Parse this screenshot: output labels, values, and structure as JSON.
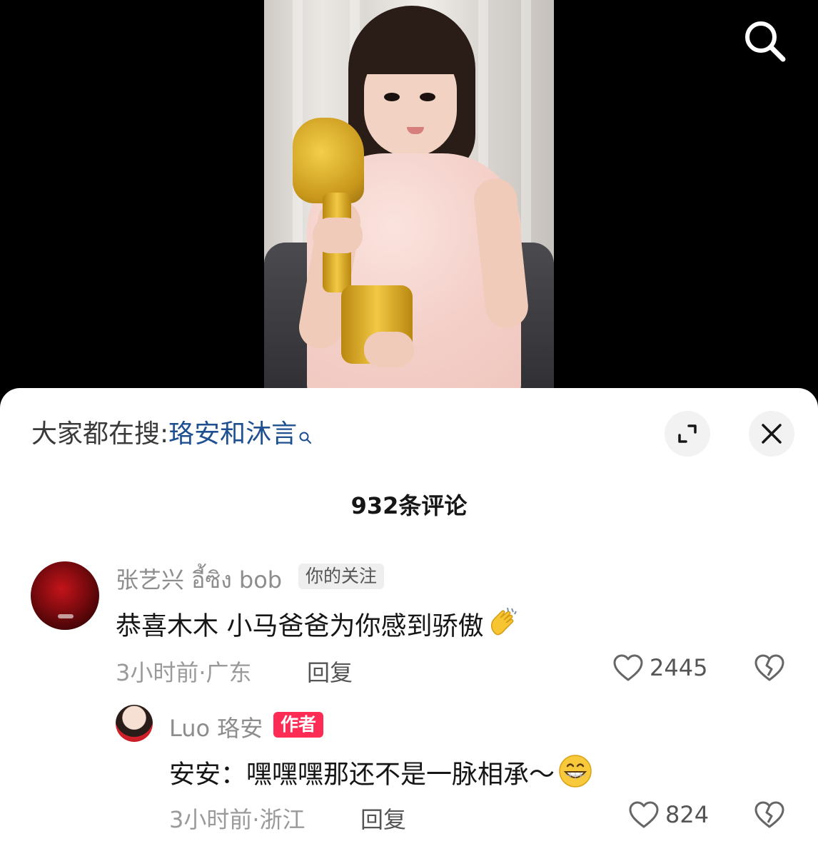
{
  "search_bar": {
    "prefix": "大家都在搜:",
    "term": "珞安和沐言"
  },
  "comments_header": {
    "title": "932条评论"
  },
  "comments": [
    {
      "username": "张艺兴 อี้ซิง bob",
      "badge": "你的关注",
      "text": "恭喜木木 小马爸爸为你感到骄傲",
      "emoji": "clapping-hands-icon",
      "meta": "3小时前·广东",
      "reply_label": "回复",
      "likes": "2445"
    },
    {
      "username": "Luo 珞安",
      "badge": "作者",
      "text": "安安：嘿嘿嘿那还不是一脉相承～",
      "emoji": "grinning-face-icon",
      "meta": "3小时前·浙江",
      "reply_label": "回复",
      "likes": "824"
    }
  ],
  "colors": {
    "sheet_background": "#ffffff",
    "trending_term": "#1d4f91",
    "author_badge": "#fe2c55",
    "follow_badge": "#eeeeee",
    "meta_text": "#9a9a9a"
  },
  "icons": {
    "top_search": "search-icon",
    "expand": "expand-icon",
    "close": "close-icon",
    "like": "heart-icon",
    "dislike": "broken-heart-icon"
  }
}
